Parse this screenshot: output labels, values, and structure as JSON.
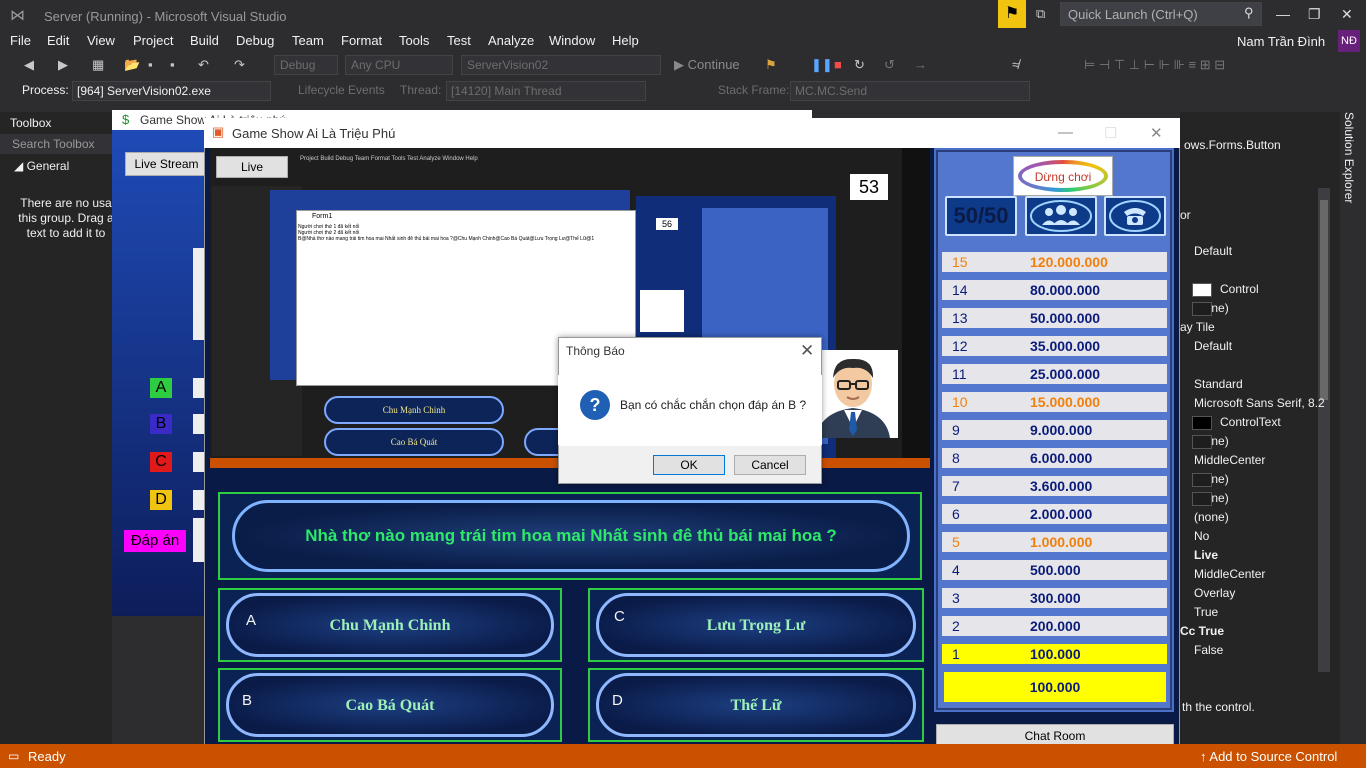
{
  "vs": {
    "title": "Server (Running) - Microsoft Visual Studio",
    "quick_launch_placeholder": "Quick Launch (Ctrl+Q)",
    "menu": [
      "File",
      "Edit",
      "View",
      "Project",
      "Build",
      "Debug",
      "Team",
      "Format",
      "Tools",
      "Test",
      "Analyze",
      "Window",
      "Help"
    ],
    "user_name": "Nam Trần Đình",
    "user_initials": "NĐ",
    "toolbar": {
      "config": "Debug",
      "platform": "Any CPU",
      "project": "ServerVision02",
      "continue_label": "Continue"
    },
    "debug_location": {
      "process_label": "Process:",
      "process_value": "[964] ServerVision02.exe",
      "lifecycle_label": "Lifecycle Events",
      "thread_label": "Thread:",
      "thread_value": "[14120] Main Thread",
      "stackframe_label": "Stack Frame:",
      "stackframe_value": "MC.MC.Send"
    },
    "toolbox": {
      "title": "Toolbox",
      "search_placeholder": "Search Toolbox",
      "group": "General",
      "empty_text": "There are no usa this group. Drag a text to add it to"
    },
    "properties": {
      "header": "ows.Forms.Button",
      "rows": [
        {
          "label": "or",
          "top": "208"
        },
        {
          "label": "Default"
        },
        {
          "label": "Control"
        },
        {
          "label": "(none)"
        },
        {
          "label": "ay  Tile"
        },
        {
          "label": "Default"
        },
        {
          "label": "Standard"
        },
        {
          "label": "Microsoft Sans Serif, 8.2"
        },
        {
          "label": "ControlText"
        },
        {
          "label": "(none)"
        },
        {
          "label": "MiddleCenter"
        },
        {
          "label": "(none)"
        },
        {
          "label": "(none)"
        },
        {
          "label": "(none)"
        },
        {
          "label": "No"
        },
        {
          "label": "Live"
        },
        {
          "label": "MiddleCenter"
        },
        {
          "label": "Overlay"
        },
        {
          "label": "True"
        },
        {
          "label": "Cc  True"
        },
        {
          "label": "False"
        }
      ],
      "footer": "th the control."
    },
    "solution_explorer_label": "Solution Explorer",
    "status": {
      "ready": "Ready",
      "source_control": "Add to Source Control"
    }
  },
  "back_window": {
    "title": "Game Show Ai Là triệu phú",
    "livestream_label": "Live Stream",
    "letters": [
      "A",
      "B",
      "C",
      "D"
    ],
    "letter_colors": [
      "#2ecc40",
      "#3a2ac8",
      "#e01a1a",
      "#f1c40f"
    ],
    "dapan_label": "Đáp án"
  },
  "main_window": {
    "title": "Game Show Ai Là Triệu Phú",
    "mirror": {
      "live_label": "Live",
      "form1_title": "Form1",
      "form1_lines": [
        "Người chơi thứ 1 đã kết nối",
        "Người chơi thứ 2 đã kết nối",
        "B@Nhà thơ nào mang trái tim hoa mai Nhất sinh đê thủ bái mai hoa ?@Chu Mạnh Chinh@Cao Bá Quát@Lưu Trọng Lư@Thế Lữ@1"
      ],
      "count_53": "53",
      "count_56": "56",
      "ans_a": "Chu Mạnh Chinh",
      "ans_b": "Cao Bá Quát",
      "ans_d": "Thế Lữ"
    },
    "dialog": {
      "title": "Thông Báo",
      "message": "Bạn có chắc chắn chọn đáp án B ?",
      "ok": "OK",
      "cancel": "Cancel"
    },
    "question": "Nhà thơ nào mang trái tim hoa mai Nhất sinh đê thủ bái mai hoa ?",
    "answers": {
      "a": {
        "letter": "A",
        "text": "Chu Mạnh Chinh"
      },
      "b": {
        "letter": "B",
        "text": "Cao Bá Quát"
      },
      "c": {
        "letter": "C",
        "text": "Lưu Trọng Lư"
      },
      "d": {
        "letter": "D",
        "text": "Thế Lữ"
      }
    },
    "stop_label": "Dừng chơi",
    "lifeline_5050": "50/50",
    "ladder": [
      {
        "level": "15",
        "amount": "120.000.000",
        "milestone": true
      },
      {
        "level": "14",
        "amount": "80.000.000",
        "milestone": false
      },
      {
        "level": "13",
        "amount": "50.000.000",
        "milestone": false
      },
      {
        "level": "12",
        "amount": "35.000.000",
        "milestone": false
      },
      {
        "level": "11",
        "amount": "25.000.000",
        "milestone": false
      },
      {
        "level": "10",
        "amount": "15.000.000",
        "milestone": true
      },
      {
        "level": "9",
        "amount": "9.000.000",
        "milestone": false
      },
      {
        "level": "8",
        "amount": "6.000.000",
        "milestone": false
      },
      {
        "level": "7",
        "amount": "3.600.000",
        "milestone": false
      },
      {
        "level": "6",
        "amount": "2.000.000",
        "milestone": false
      },
      {
        "level": "5",
        "amount": "1.000.000",
        "milestone": true
      },
      {
        "level": "4",
        "amount": "500.000",
        "milestone": false
      },
      {
        "level": "3",
        "amount": "300.000",
        "milestone": false
      },
      {
        "level": "2",
        "amount": "200.000",
        "milestone": false
      },
      {
        "level": "1",
        "amount": "100.000",
        "milestone": false,
        "current": true
      }
    ],
    "current_prize": "100.000",
    "chat_room_label": "Chat Room"
  }
}
